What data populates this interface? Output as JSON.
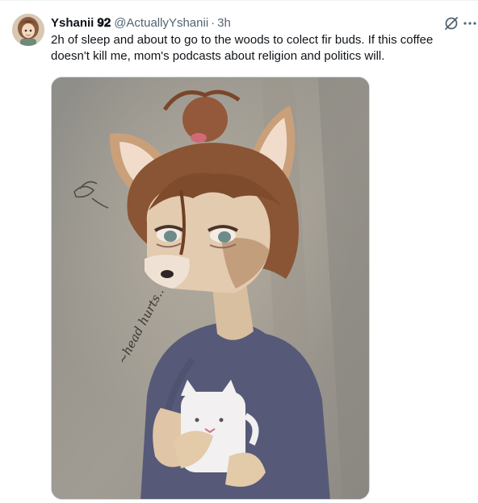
{
  "tweet": {
    "display_name": "Yshanii 𝟗𝟐",
    "handle": "@ActuallyYshanii",
    "separator": "·",
    "time": "3h",
    "text": "2h of sleep and about to go to the woods to colect fir buds. If this coffee doesn't kill me, mom's podcasts about religion and politics will."
  },
  "media": {
    "handwritten_note": "~head hurts.."
  },
  "icons": {
    "grok": "grok-icon",
    "more": "more-icon"
  },
  "colors": {
    "text": "#0f1419",
    "muted": "#536471",
    "border": "#cfd9de"
  }
}
